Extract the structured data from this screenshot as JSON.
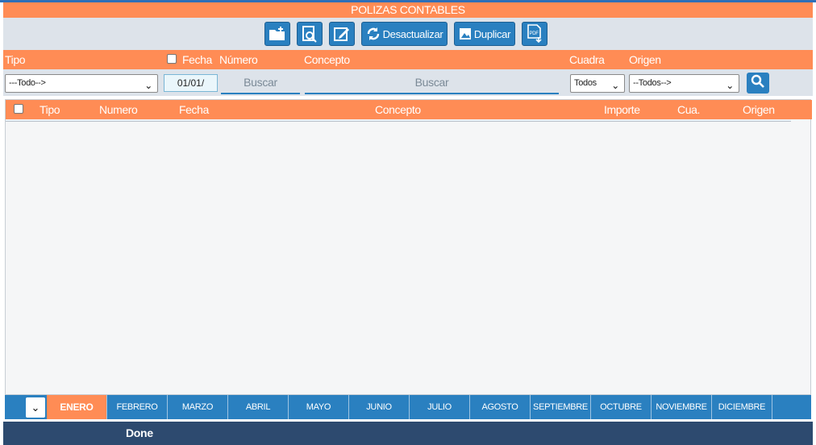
{
  "window": {
    "title": "POLIZAS CONTABLES"
  },
  "toolbar": {
    "buttons": [
      {
        "icon": "new-folder-icon",
        "label": ""
      },
      {
        "icon": "view-document-icon",
        "label": ""
      },
      {
        "icon": "edit-icon",
        "label": ""
      },
      {
        "icon": "refresh-icon",
        "label": "Desactualizar"
      },
      {
        "icon": "duplicate-icon",
        "label": "Duplicar"
      },
      {
        "icon": "pdf-icon",
        "label": ""
      }
    ]
  },
  "filters": {
    "labels": {
      "tipo": "Tipo",
      "fecha": "Fecha",
      "numero": "Número",
      "concepto": "Concepto",
      "cuadra": "Cuadra",
      "origen": "Origen"
    },
    "tipo_value": "---Todo-->",
    "fecha_value": "01/01/",
    "numero_placeholder": "Buscar",
    "concepto_placeholder": "Buscar",
    "cuadra_value": "Todos",
    "origen_value": "--Todos-->"
  },
  "grid": {
    "columns": [
      "Tipo",
      "Numero",
      "Fecha",
      "Concepto",
      "Importe",
      "Cua.",
      "Origen"
    ],
    "rows": []
  },
  "months": {
    "year_arrow": "⌄",
    "items": [
      "ENERO",
      "FEBRERO",
      "MARZO",
      "ABRIL",
      "MAYO",
      "JUNIO",
      "JULIO",
      "AGOSTO",
      "SEPTIEMBRE",
      "OCTUBRE",
      "NOVIEMBRE",
      "DICIEMBRE"
    ],
    "active": "ENERO"
  },
  "status": {
    "text": "Done"
  },
  "colors": {
    "accent_orange": "#ff8c55",
    "primary_blue": "#2a80c0",
    "status_navy": "#2d4a6f"
  }
}
